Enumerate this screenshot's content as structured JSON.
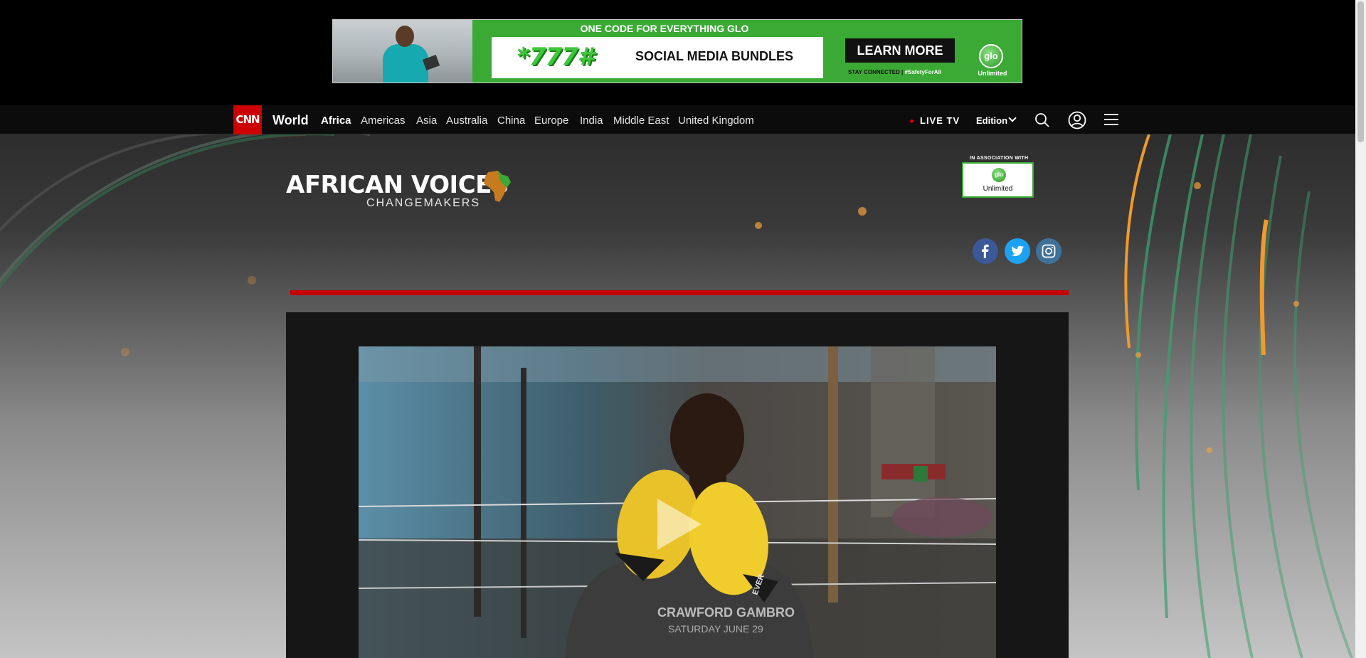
{
  "ad": {
    "headline": "ONE CODE FOR EVERYTHING GLO",
    "code": "*777#",
    "product": "SOCIAL MEDIA BUNDLES",
    "cta": "LEARN MORE",
    "tagline_prefix": "STAY CONNECTED | ",
    "hashtag": "#SafetyForAll",
    "brand": "glo",
    "brand_sub": "Unlimited",
    "brand_color": "#3aaa35"
  },
  "nav": {
    "logo": "CNN",
    "section": "World",
    "links": [
      "Africa",
      "Americas",
      "Asia",
      "Australia",
      "China",
      "Europe",
      "India",
      "Middle East",
      "United Kingdom"
    ],
    "active_link": "Africa",
    "live_tv": "LIVE TV",
    "edition": "Edition",
    "icons": [
      "search-icon",
      "account-icon",
      "menu-icon"
    ],
    "accent_color": "#cc0000"
  },
  "hero": {
    "title": "AFRICAN VOICES",
    "subtitle": "CHANGEMAKERS",
    "sponsor_label": "IN ASSOCIATION WITH",
    "sponsor_brand": "glo",
    "sponsor_sub": "Unlimited",
    "social": [
      "facebook-icon",
      "twitter-icon",
      "instagram-icon"
    ]
  },
  "video": {
    "shirt_text": "CRAWFORD GAMBRO",
    "shirt_text_2": "SATURDAY JUNE 29",
    "glove_label": "EVER",
    "icon": "play-icon"
  }
}
